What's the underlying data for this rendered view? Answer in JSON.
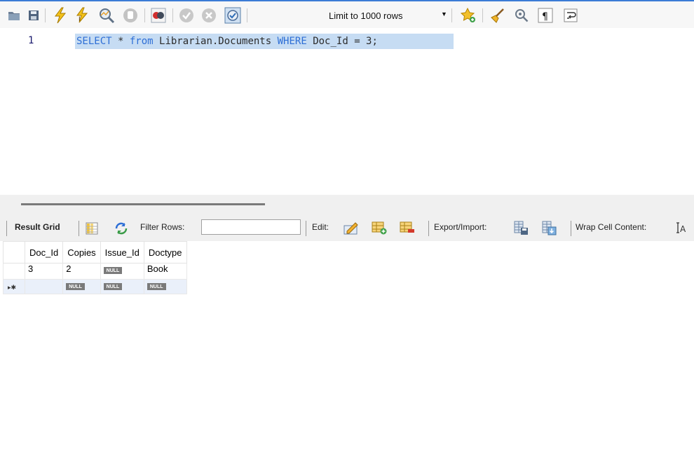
{
  "toolbar": {
    "limit_select": "Limit to 1000 rows"
  },
  "editor": {
    "line_number": "1",
    "sql": {
      "kw_select": "SELECT",
      "star": " * ",
      "kw_from": "from",
      "table": " Librarian.Documents ",
      "kw_where": "WHERE",
      "condition": " Doc_Id = 3;"
    }
  },
  "result_toolbar": {
    "result_grid": "Result Grid",
    "filter_rows": "Filter Rows:",
    "filter_value": "",
    "edit": "Edit:",
    "export_import": "Export/Import:",
    "wrap_cell_content": "Wrap Cell Content:"
  },
  "grid": {
    "columns": [
      "Doc_Id",
      "Copies",
      "Issue_Id",
      "Doctype"
    ],
    "rows": [
      [
        "3",
        "2",
        "NULL",
        "Book"
      ]
    ],
    "new_row": [
      "",
      "NULL",
      "NULL",
      "NULL"
    ]
  }
}
